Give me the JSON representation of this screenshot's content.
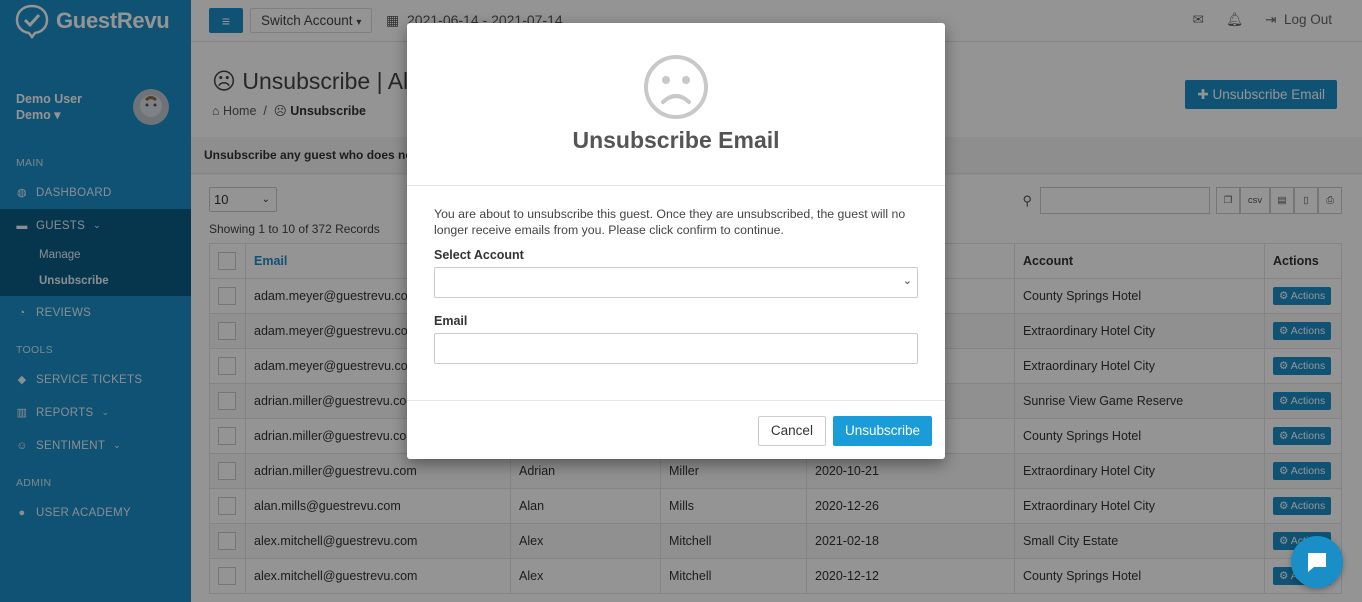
{
  "app": {
    "name": "GuestRevu"
  },
  "sidebar": {
    "user_name": "Demo User",
    "user_role": "Demo",
    "sections": {
      "main": "MAIN",
      "tools": "TOOLS",
      "admin": "ADMIN"
    },
    "items": {
      "dashboard": "DASHBOARD",
      "guests": "GUESTS",
      "manage": "Manage",
      "unsubscribe": "Unsubscribe",
      "reviews": "REVIEWS",
      "service_tickets": "SERVICE TICKETS",
      "reports": "REPORTS",
      "sentiment": "SENTIMENT",
      "user_academy": "USER ACADEMY"
    }
  },
  "topbar": {
    "switch_account": "Switch Account",
    "date_range": "2021-06-14 - 2021-07-14",
    "logout": "Log Out"
  },
  "page": {
    "title": "Unsubscribe | All",
    "breadcrumb_home": "Home",
    "breadcrumb_current": "Unsubscribe",
    "add_button": "Unsubscribe Email",
    "description": "Unsubscribe any guest who does no"
  },
  "table_controls": {
    "page_length": "10",
    "showing": "Showing 1 to 10 of 372 Records",
    "csv_label": "csv"
  },
  "table": {
    "headers": {
      "email": "Email",
      "account": "Account",
      "actions": "Actions"
    },
    "action_label": "Actions",
    "rows": [
      {
        "email": "adam.meyer@guestrevu.com",
        "first": "",
        "last": "",
        "date": "",
        "account": "County Springs Hotel"
      },
      {
        "email": "adam.meyer@guestrevu.com",
        "first": "",
        "last": "",
        "date": "",
        "account": "Extraordinary Hotel City"
      },
      {
        "email": "adam.meyer@guestrevu.com",
        "first": "",
        "last": "",
        "date": "",
        "account": "Extraordinary Hotel City"
      },
      {
        "email": "adrian.miller@guestrevu.com",
        "first": "",
        "last": "",
        "date": "",
        "account": "Sunrise View Game Reserve"
      },
      {
        "email": "adrian.miller@guestrevu.com",
        "first": "",
        "last": "",
        "date": "",
        "account": "County Springs Hotel"
      },
      {
        "email": "adrian.miller@guestrevu.com",
        "first": "Adrian",
        "last": "Miller",
        "date": "2020-10-21",
        "account": "Extraordinary Hotel City"
      },
      {
        "email": "alan.mills@guestrevu.com",
        "first": "Alan",
        "last": "Mills",
        "date": "2020-12-26",
        "account": "Extraordinary Hotel City"
      },
      {
        "email": "alex.mitchell@guestrevu.com",
        "first": "Alex",
        "last": "Mitchell",
        "date": "2021-02-18",
        "account": "Small City Estate"
      },
      {
        "email": "alex.mitchell@guestrevu.com",
        "first": "Alex",
        "last": "Mitchell",
        "date": "2020-12-12",
        "account": "County Springs Hotel"
      }
    ]
  },
  "modal": {
    "title": "Unsubscribe Email",
    "message": "You are about to unsubscribe this guest. Once they are unsubscribed, the guest will no longer receive emails from you. Please click confirm to continue.",
    "select_account_label": "Select Account",
    "select_account_value": "",
    "email_label": "Email",
    "email_value": "",
    "cancel": "Cancel",
    "confirm": "Unsubscribe"
  },
  "colors": {
    "brand": "#1a8ec7",
    "sidebar_active": "#0c5d85",
    "confirm": "#1a9cd8"
  }
}
